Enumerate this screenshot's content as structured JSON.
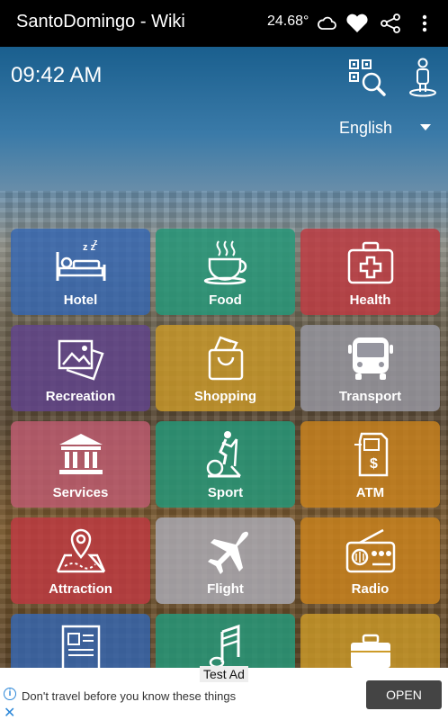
{
  "appbar": {
    "title": "SantoDomingo - Wiki",
    "temperature": "24.68°",
    "icons": [
      "cloud-icon",
      "heart-icon",
      "share-icon",
      "more-vert-icon"
    ]
  },
  "header": {
    "time": "09:42 AM",
    "language": "English"
  },
  "tiles": [
    {
      "label": "Hotel",
      "icon": "hotel-bed-icon",
      "color": "#3466b2"
    },
    {
      "label": "Food",
      "icon": "coffee-cup-icon",
      "color": "#269678"
    },
    {
      "label": "Health",
      "icon": "first-aid-kit-icon",
      "color": "#be3a42"
    },
    {
      "label": "Recreation",
      "icon": "pictures-icon",
      "color": "#60448c"
    },
    {
      "label": "Shopping",
      "icon": "shopping-bag-icon",
      "color": "#cd9b28"
    },
    {
      "label": "Transport",
      "icon": "bus-icon",
      "color": "#9696a0"
    },
    {
      "label": "Services",
      "icon": "bank-building-icon",
      "color": "#be5c70"
    },
    {
      "label": "Sport",
      "icon": "elliptical-trainer-icon",
      "color": "#269678"
    },
    {
      "label": "ATM",
      "icon": "atm-machine-icon",
      "color": "#c8821e"
    },
    {
      "label": "Attraction",
      "icon": "map-pin-icon",
      "color": "#be3a42"
    },
    {
      "label": "Flight",
      "icon": "airplane-icon",
      "color": "#aaaab4"
    },
    {
      "label": "Radio",
      "icon": "radio-icon",
      "color": "#c8821e"
    },
    {
      "label": "",
      "icon": "newspaper-icon",
      "color": "#3466b2"
    },
    {
      "label": "",
      "icon": "music-note-icon",
      "color": "#269678"
    },
    {
      "label": "",
      "icon": "briefcase-icon",
      "color": "#cd9b28"
    }
  ],
  "ad": {
    "badge": "Test Ad",
    "text": "Don't travel before you know these things",
    "button": "OPEN"
  }
}
